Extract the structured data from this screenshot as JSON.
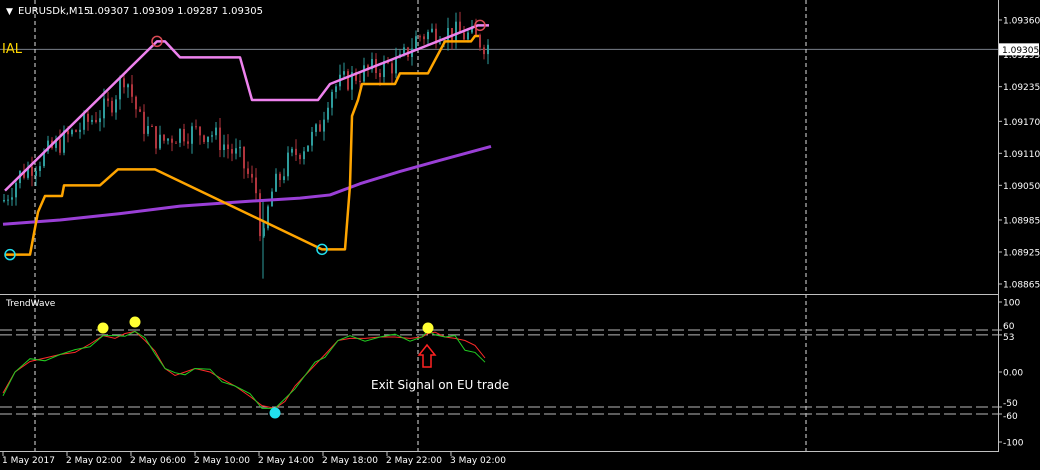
{
  "window": {
    "header_arrow": "▼",
    "symbol": "EURUSDk,M15",
    "ohlc": "1.09307 1.09309 1.09287 1.09305",
    "left_overlay_label": "IAL"
  },
  "indicator": {
    "name": "TrendWave",
    "annotation": "Exit Signal on EU trade"
  },
  "price_axis": {
    "ticks": [
      "1.09360",
      "1.09295",
      "1.09235",
      "1.09170",
      "1.09110",
      "1.09050",
      "1.08985",
      "1.08925",
      "1.08865"
    ],
    "current_price": "1.09305",
    "ylim": [
      1.08865,
      1.0936
    ]
  },
  "osc_axis": {
    "ticks": [
      "100",
      "60",
      "53",
      "0.00",
      "-50",
      "-60",
      "-100"
    ],
    "ylim": [
      -100,
      100
    ]
  },
  "time_axis": {
    "labels": [
      "1 May 2017",
      "2 May 02:00",
      "2 May 06:00",
      "2 May 10:00",
      "2 May 14:00",
      "2 May 18:00",
      "2 May 22:00",
      "3 May 02:00"
    ]
  },
  "colors": {
    "background": "#000000",
    "grid_separator": "#c0c0c0",
    "text": "#ffffff",
    "bull_candle": "#2e9c9c",
    "bear_candle": "#b0353d",
    "pink_line": "#ee82ee",
    "orange_line": "#ffa500",
    "purple_line": "#9a3fd6",
    "osc_red": "#ff2a2a",
    "osc_green": "#22cc22",
    "signal_yellow": "#ffff33",
    "signal_cyan": "#22e0ee",
    "arrow_red": "#ff2222",
    "overlay_label": "#ffd700"
  },
  "chart_data": [
    {
      "type": "line",
      "title": "EURUSDk,M15",
      "x": [
        "1 May 2017",
        "2 May 02:00",
        "2 May 06:00",
        "2 May 10:00",
        "2 May 14:00",
        "2 May 18:00",
        "2 May 22:00",
        "3 May 02:00"
      ],
      "ylim": [
        1.08865,
        1.0936
      ],
      "series": [
        {
          "values": [
            1.0904,
            1.0928,
            1.0928,
            1.0919,
            1.0919,
            1.0922,
            1.0935,
            1.0935
          ]
        },
        {
          "values": [
            1.0892,
            1.0903,
            1.0909,
            1.0904,
            1.0893,
            1.0905,
            1.0924,
            1.0931
          ]
        },
        {
          "values": [
            1.0899,
            1.0899,
            1.09,
            1.0902,
            1.0904,
            1.0905,
            1.0911,
            1.0914
          ]
        }
      ],
      "markers": [
        {
          "x": "1 May 2017",
          "y": 1.0892,
          "color": "cyan"
        },
        {
          "x": "2 May 06:00",
          "y": 1.0928,
          "color": "red"
        },
        {
          "x": "2 May 18:00",
          "y": 1.0893,
          "color": "cyan"
        },
        {
          "x": "3 May 02:00",
          "y": 1.0935,
          "color": "red"
        }
      ]
    },
    {
      "type": "line",
      "title": "TrendWave",
      "ylim": [
        -100,
        100
      ],
      "levels": [
        60,
        53,
        -50,
        -60
      ],
      "signals": [
        {
          "x": "2 May 02:00",
          "value": 55,
          "color": "yellow"
        },
        {
          "x": "2 May 06:00",
          "value": 60,
          "color": "yellow"
        },
        {
          "x": "2 May 14:00",
          "value": -52,
          "color": "cyan"
        },
        {
          "x": "2 May 22:00",
          "value": 55,
          "color": "yellow"
        }
      ]
    }
  ]
}
